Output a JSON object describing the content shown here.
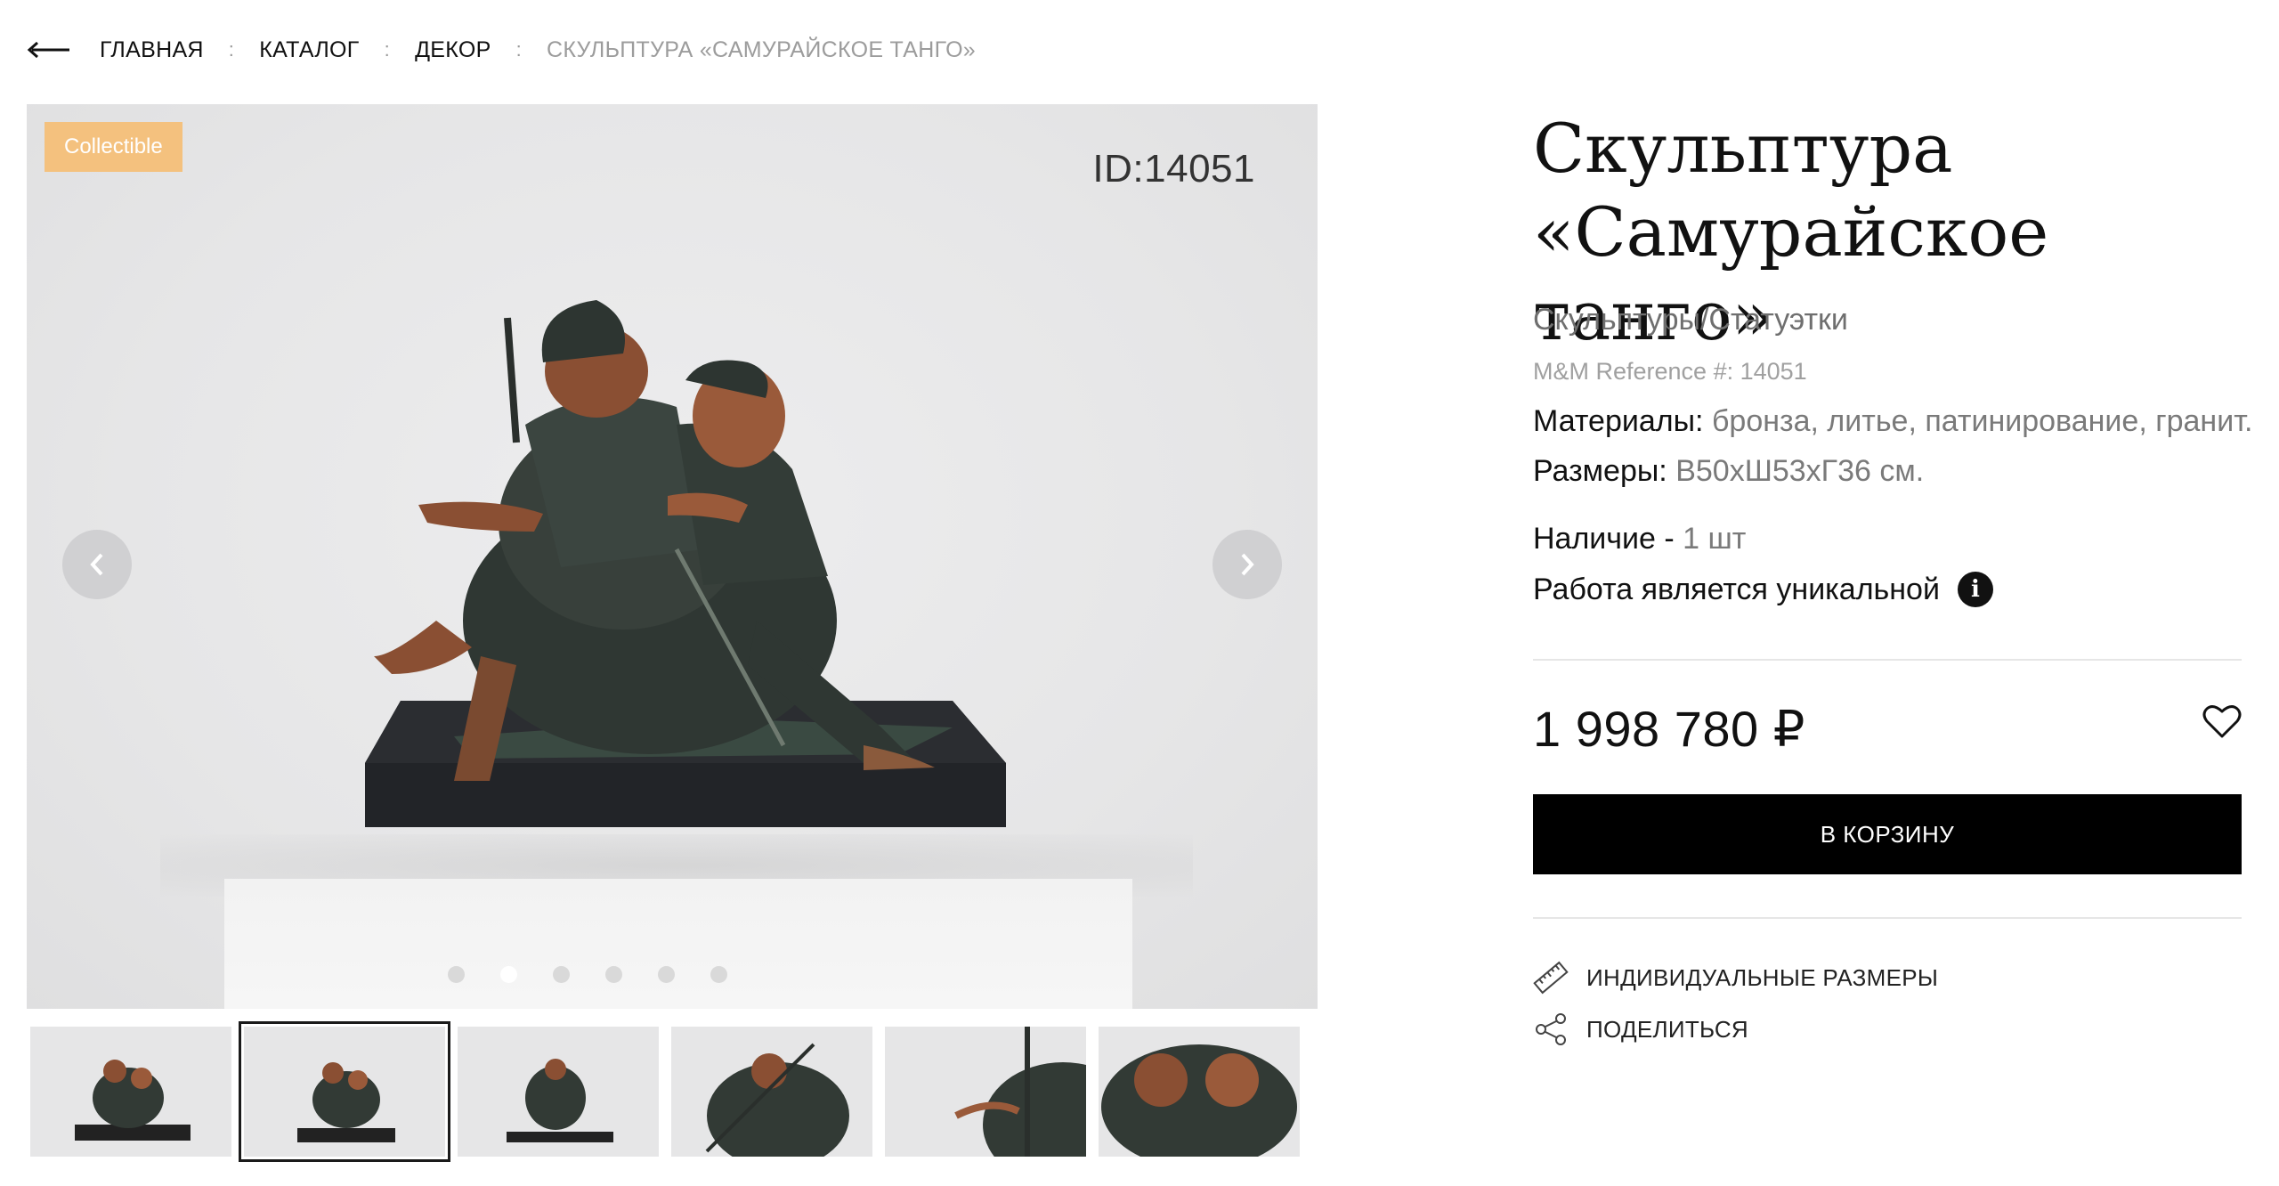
{
  "breadcrumb": {
    "back_icon": "arrow-left-icon",
    "items": [
      {
        "label": "ГЛАВНАЯ"
      },
      {
        "label": "КАТАЛОГ"
      },
      {
        "label": "ДЕКОР"
      }
    ],
    "separator": ":",
    "current": "СКУЛЬПТУРА «САМУРАЙСКОЕ ТАНГО»"
  },
  "gallery": {
    "badge": "Collectible",
    "badge_color": "#f4c17e",
    "id_label": "ID:14051",
    "prev_icon": "chevron-left-icon",
    "next_icon": "chevron-right-icon",
    "dots_count": 6,
    "active_dot": 2,
    "thumbnails_count": 6,
    "active_thumbnail": 2
  },
  "product": {
    "title_line1": "Скульптура",
    "title_line2": "«Самурайское танго»",
    "category": "Скульптуры/Статуэтки",
    "reference": "M&M Reference #: 14051",
    "materials_label": "Материалы:",
    "materials_value": "бронза, литье, патинирование, гранит.",
    "dimensions_label": "Размеры:",
    "dimensions_value": "В50хШ53хГ36 см.",
    "availability_label": "Наличие -",
    "availability_value": "1 шт",
    "unique_text": "Работа является уникальной",
    "unique_icon": "info-icon",
    "price": "1 998 780 ₽",
    "favorite_icon": "heart-icon",
    "cart_button": "В КОРЗИНУ",
    "custom_sizes": "ИНДИВИДУАЛЬНЫЕ РАЗМЕРЫ",
    "custom_sizes_icon": "ruler-icon",
    "share": "ПОДЕЛИТЬСЯ",
    "share_icon": "share-icon"
  }
}
